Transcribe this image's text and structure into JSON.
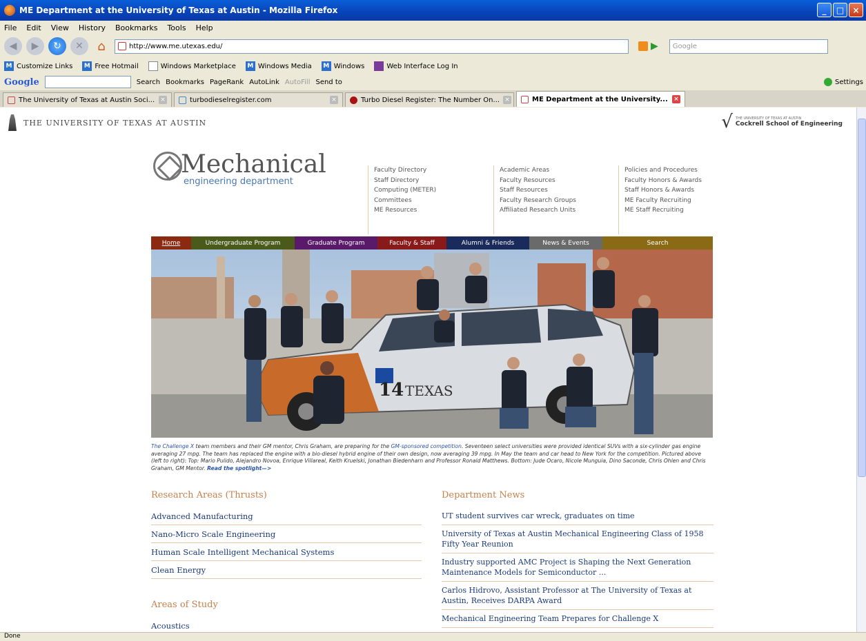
{
  "window": {
    "title": "ME Department at the University of Texas at Austin - Mozilla Firefox"
  },
  "menu": [
    "File",
    "Edit",
    "View",
    "History",
    "Bookmarks",
    "Tools",
    "Help"
  ],
  "url": "http://www.me.utexas.edu/",
  "search_placeholder": "Google",
  "bookmarks": [
    "Customize Links",
    "Free Hotmail",
    "Windows Marketplace",
    "Windows Media",
    "Windows",
    "Web Interface Log In"
  ],
  "google_toolbar": {
    "logo": "Google",
    "items": [
      "Search",
      "Bookmarks",
      "PageRank",
      "AutoLink",
      "AutoFill",
      "Send to",
      "Settings"
    ]
  },
  "tabs": [
    {
      "label": "The University of Texas at Austin Soci..."
    },
    {
      "label": "turbodieselregister.com"
    },
    {
      "label": "Turbo Diesel Register: The Number On..."
    },
    {
      "label": "ME Department at the University..."
    }
  ],
  "status": "Done",
  "page": {
    "ut_name": "THE UNIVERSITY OF TEXAS AT AUSTIN",
    "cockrell_small": "THE UNIVERSITY OF TEXAS AT AUSTIN",
    "cockrell": "Cockrell School of Engineering",
    "logo_main": "Mechanical",
    "logo_sub": "engineering department",
    "link_cols": [
      [
        "Faculty Directory",
        "Staff Directory",
        "Computing (METER)",
        "Committees",
        "ME Resources"
      ],
      [
        "Academic Areas",
        "Faculty Resources",
        "Staff Resources",
        "Faculty Research Groups",
        "Affiliated Research Units"
      ],
      [
        "Policies and Procedures",
        "Faculty Honors & Awards",
        "Staff Honors & Awards",
        "ME Faculty Recruiting",
        "ME Staff Recruiting"
      ]
    ],
    "nav": [
      {
        "label": "Home",
        "color": "#8b2a10"
      },
      {
        "label": "Undergraduate Program",
        "color": "#4a5a1a"
      },
      {
        "label": "Graduate Program",
        "color": "#5a1a6a"
      },
      {
        "label": "Faculty & Staff",
        "color": "#8a1a1a"
      },
      {
        "label": "Alumni & Friends",
        "color": "#1a2a5a"
      },
      {
        "label": "News & Events",
        "color": "#6a6a6a"
      },
      {
        "label": "Search",
        "color": "#8a6a14"
      }
    ],
    "car_number": "14",
    "car_text": "TEXAS",
    "caption_parts": {
      "a": "The Challenge X",
      "b": " team members and their GM mentor, Chris Graham, are preparing for the ",
      "c": "GM-sponsored competition",
      "d": ". Seventeen select universities were provided identical SUVs with a six-cylinder gas engine averaging 27 mpg. The team has replaced the engine with a bio-diesel hybrid engine of their own design, now averaging 39 mpg. In May the team and car head to New York for the competition. Pictured above (left to right): Top: Mario Pulido, Alejandro Novoa, Enrique Villareal, Keith Kruelski, Jonathan Biedenharn and Professor Ronald Matthews. Bottom: Jude Ocaro, Nicole Munguia, Dino Saconde, Chris Ohlen and Chris Graham, GM Mentor. ",
      "e": "Read the spotlight—>"
    },
    "research_title": "Research Areas (Thrusts)",
    "research": [
      "Advanced Manufacturing",
      "Nano-Micro Scale Engineering",
      "Human Scale Intelligent Mechanical Systems",
      "Clean Energy"
    ],
    "study_title": "Areas of Study",
    "study": [
      "Acoustics"
    ],
    "news_title": "Department News",
    "news": [
      "UT student survives car wreck, graduates on time",
      "University of Texas at Austin Mechanical Engineering Class of 1958 Fifty Year Reunion",
      "Industry supported AMC Project is Shaping the Next Generation Maintenance Models for Semiconductor ...",
      "Carlos Hidrovo, Assistant Professor at The University of Texas at Austin, Receives DARPA Award",
      "Mechanical Engineering Team Prepares for Challenge X"
    ]
  }
}
